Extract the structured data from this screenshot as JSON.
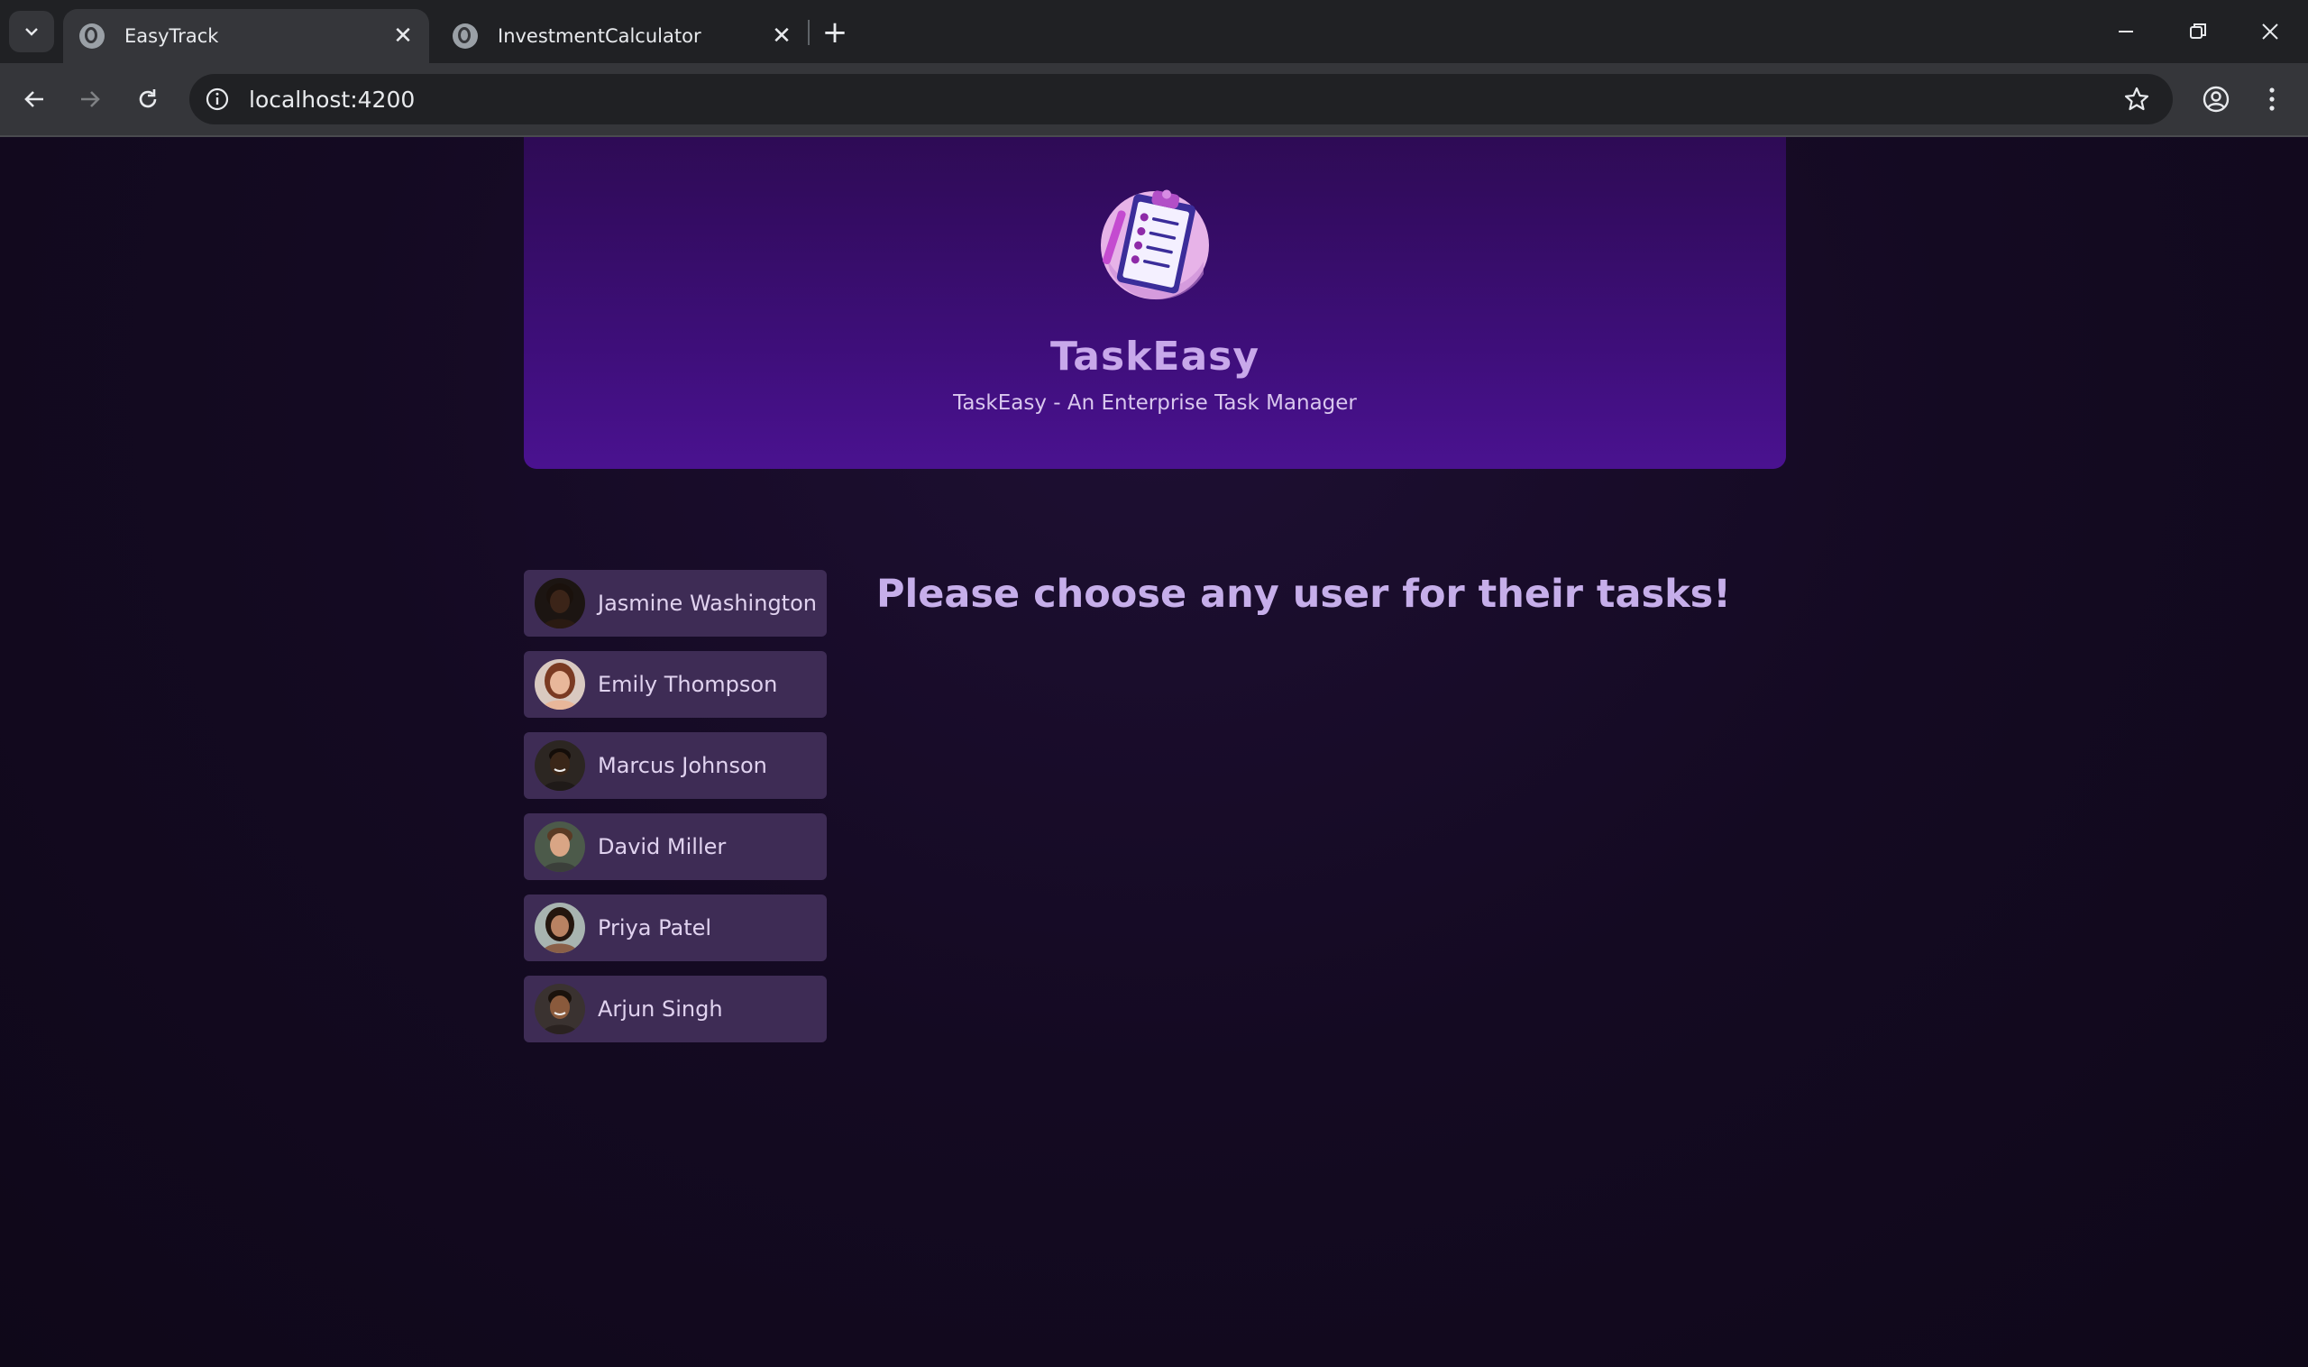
{
  "browser": {
    "tabs": [
      {
        "title": "EasyTrack",
        "active": true
      },
      {
        "title": "InvestmentCalculator",
        "active": false
      }
    ],
    "url": "localhost:4200"
  },
  "header": {
    "title": "TaskEasy",
    "subtitle": "TaskEasy - An Enterprise Task Manager",
    "logo_icon": "clipboard-checklist-icon"
  },
  "users": [
    {
      "name": "Jasmine Washington",
      "skin": "#3b2418",
      "hair": "#1a110c",
      "bg": "#1c1512"
    },
    {
      "name": "Emily Thompson",
      "skin": "#e8b79a",
      "hair": "#7a3a22",
      "bg": "#d9c9c0"
    },
    {
      "name": "Marcus Johnson",
      "skin": "#3a2618",
      "hair": "#140d09",
      "bg": "#2c2622"
    },
    {
      "name": "David Miller",
      "skin": "#d9a585",
      "hair": "#5a3a24",
      "bg": "#4c5a4a"
    },
    {
      "name": "Priya Patel",
      "skin": "#b88262",
      "hair": "#24160e",
      "bg": "#a8b4b0"
    },
    {
      "name": "Arjun Singh",
      "skin": "#8a5a3c",
      "hair": "#1a120c",
      "bg": "#3a3230"
    }
  ],
  "fallback_text": "Please choose any user for their tasks!",
  "colors": {
    "page_bg": "#120a1d",
    "header_bg": "#3d0e78",
    "user_item_bg": "#3e2c55",
    "title_text": "#c8a8ea"
  }
}
